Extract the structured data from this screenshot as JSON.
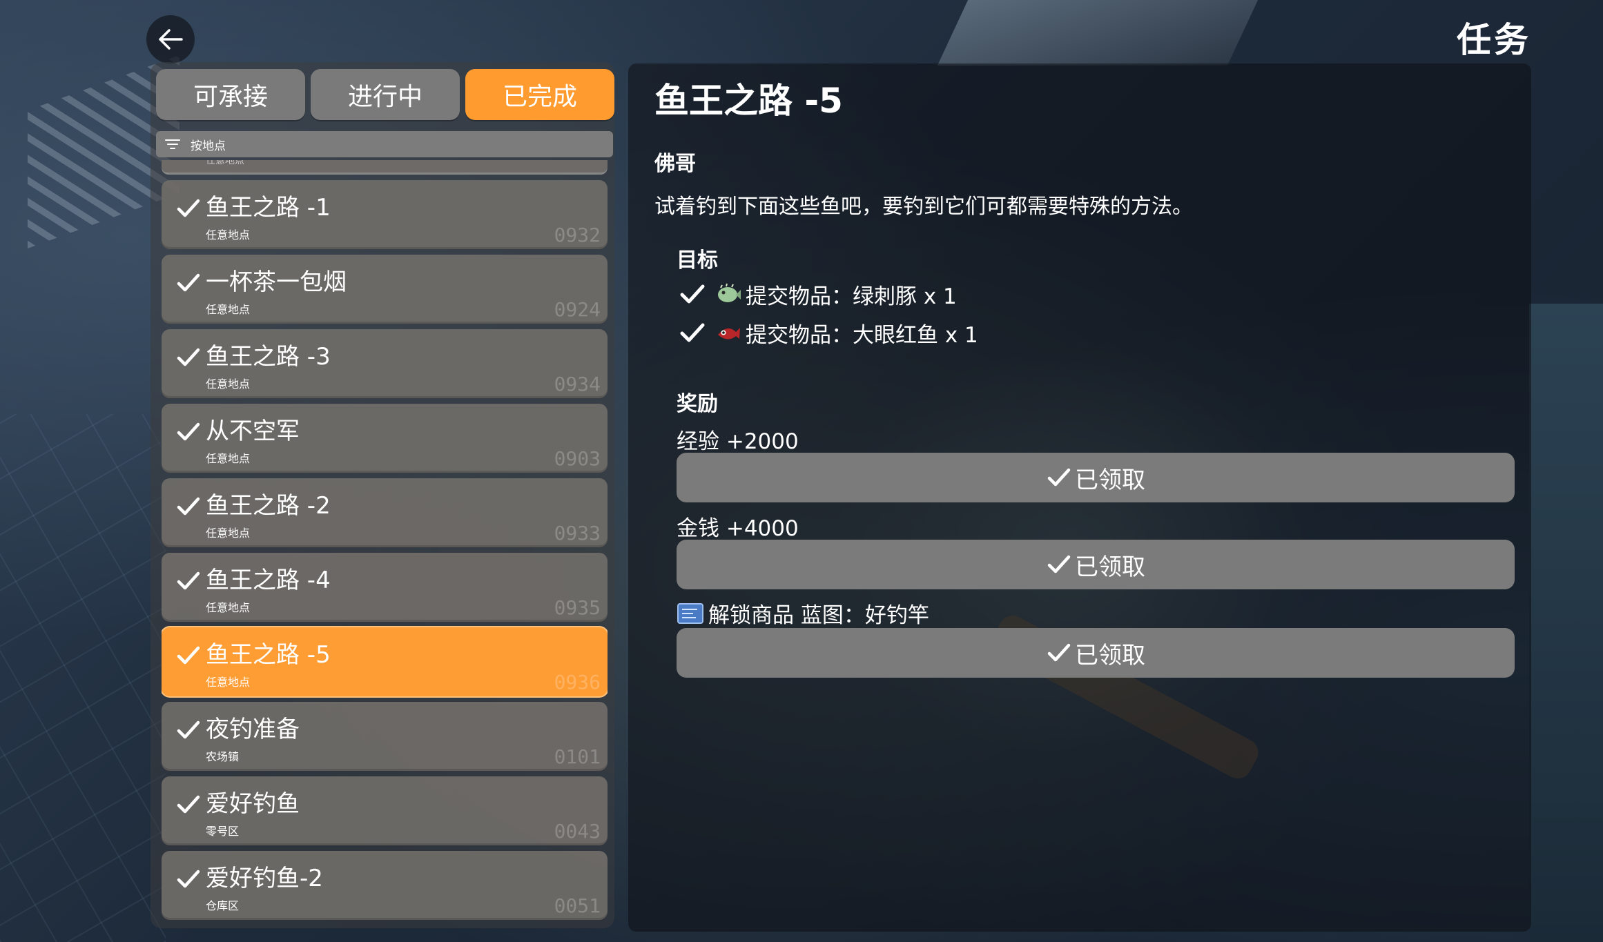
{
  "header": {
    "title": "任务"
  },
  "tabs": [
    {
      "label": "可承接",
      "active": false
    },
    {
      "label": "进行中",
      "active": false
    },
    {
      "label": "已完成",
      "active": true
    }
  ],
  "filter": {
    "label": "按地点"
  },
  "list_peek_text": "任意地点",
  "quests": [
    {
      "name": "鱼王之路 -1",
      "location": "任意地点",
      "id": "0932",
      "selected": false
    },
    {
      "name": "一杯茶一包烟",
      "location": "任意地点",
      "id": "0924",
      "selected": false
    },
    {
      "name": "鱼王之路 -3",
      "location": "任意地点",
      "id": "0934",
      "selected": false
    },
    {
      "name": "从不空军",
      "location": "任意地点",
      "id": "0903",
      "selected": false
    },
    {
      "name": "鱼王之路 -2",
      "location": "任意地点",
      "id": "0933",
      "selected": false
    },
    {
      "name": "鱼王之路 -4",
      "location": "任意地点",
      "id": "0935",
      "selected": false
    },
    {
      "name": "鱼王之路 -5",
      "location": "任意地点",
      "id": "0936",
      "selected": true
    },
    {
      "name": "夜钓准备",
      "location": "农场镇",
      "id": "0101",
      "selected": false
    },
    {
      "name": "爱好钓鱼",
      "location": "零号区",
      "id": "0043",
      "selected": false
    },
    {
      "name": "爱好钓鱼-2",
      "location": "仓库区",
      "id": "0051",
      "selected": false
    }
  ],
  "detail": {
    "title": "鱼王之路 -5",
    "giver": "佛哥",
    "description": "试着钓到下面这些鱼吧，要钓到它们可都需要特殊的方法。",
    "objectives_title": "目标",
    "objectives": [
      {
        "text": "提交物品：绿刺豚 x 1",
        "icon": "green-pufferfish-icon"
      },
      {
        "text": "提交物品：大眼红鱼 x 1",
        "icon": "red-bigeye-fish-icon"
      }
    ],
    "rewards_title": "奖励",
    "rewards": [
      {
        "label": "经验 +2000",
        "button": "已领取"
      },
      {
        "label": "金钱 +4000",
        "button": "已领取"
      },
      {
        "label": "解锁商品 蓝图：好钓竿",
        "button": "已领取",
        "icon": "blueprint-icon"
      }
    ]
  },
  "colors": {
    "accent": "#ff9b2f",
    "tab_inactive": "#7a7a7a",
    "claimed_button": "#7b7b7b"
  }
}
